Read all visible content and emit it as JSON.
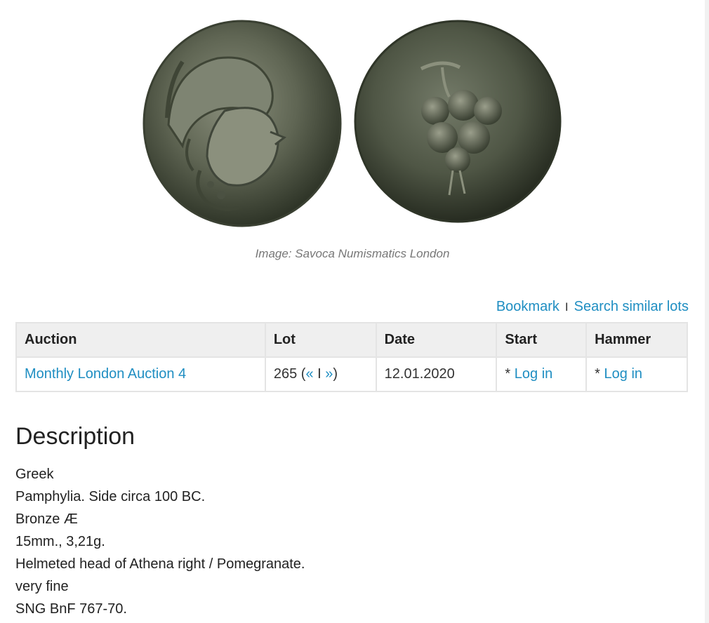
{
  "image": {
    "caption": "Image: Savoca Numismatics London",
    "obverse_label": "obverse: helmeted head of Athena",
    "reverse_label": "reverse: pomegranate"
  },
  "actions": {
    "bookmark": "Bookmark",
    "separator": "I",
    "search_similar": "Search similar lots"
  },
  "table": {
    "headers": [
      "Auction",
      "Lot",
      "Date",
      "Start",
      "Hammer"
    ],
    "row": {
      "auction": "Monthly London Auction 4",
      "lot_number": "265",
      "lot_prev": "«",
      "lot_sep": "I",
      "lot_next": "»",
      "date": "12.01.2020",
      "start_prefix": "*",
      "start_link": "Log in",
      "hammer_prefix": "*",
      "hammer_link": "Log in"
    }
  },
  "description": {
    "title": "Description",
    "lines": [
      "Greek",
      "Pamphylia. Side circa 100 BC.",
      "Bronze Æ",
      "15mm., 3,21g.",
      "Helmeted head of Athena right / Pomegranate.",
      "very fine",
      "SNG BnF 767-70."
    ]
  },
  "colors": {
    "link": "#1f8ec2",
    "header_bg": "#efefef",
    "border": "#e4e4e4",
    "coin_dark": "#2f3528",
    "coin_mid": "#6b7160"
  }
}
